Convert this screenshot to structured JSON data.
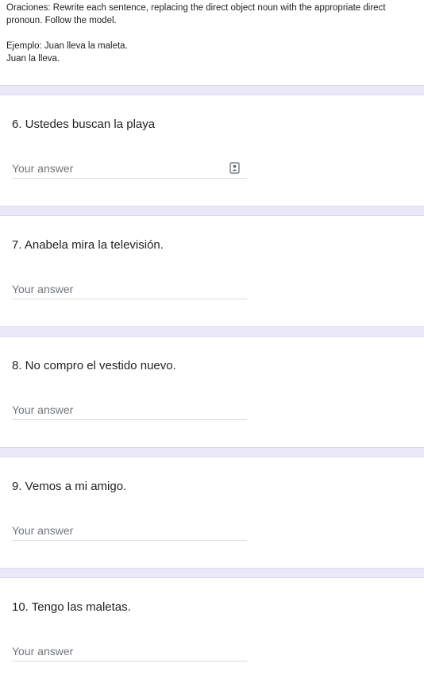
{
  "instructions": {
    "line1": "Oraciones: Rewrite each sentence, replacing the direct object noun with the appropriate direct",
    "line2": "pronoun. Follow the model.",
    "example_line1": "Ejemplo: Juan lleva la maleta.",
    "example_line2": "Juan la lleva."
  },
  "questions": [
    {
      "title": "6. Ustedes buscan la playa",
      "placeholder": "Your answer",
      "has_autofill_icon": true
    },
    {
      "title": "7. Anabela mira la televisión.",
      "placeholder": "Your answer",
      "has_autofill_icon": false
    },
    {
      "title": "8. No compro el vestido nuevo.",
      "placeholder": "Your answer",
      "has_autofill_icon": false
    },
    {
      "title": "9. Vemos a mi amigo.",
      "placeholder": "Your answer",
      "has_autofill_icon": false
    },
    {
      "title": "10. Tengo las maletas.",
      "placeholder": "Your answer",
      "has_autofill_icon": false
    }
  ],
  "colors": {
    "divider": "#ebe9f7",
    "text": "#202124",
    "placeholder": "#70757a",
    "underline": "#dadce0"
  },
  "icons": {
    "autofill": "contact-card-icon"
  }
}
